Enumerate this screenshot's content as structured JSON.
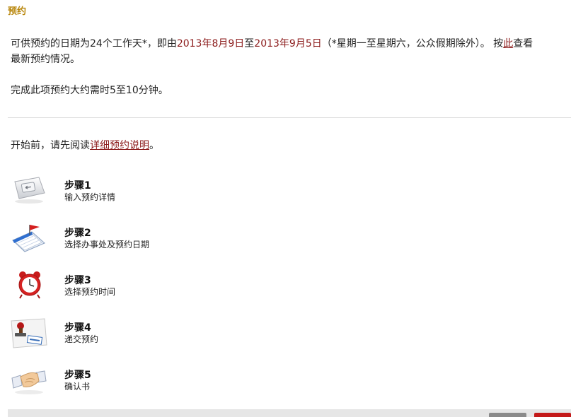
{
  "page": {
    "title": "预约"
  },
  "intro": {
    "line1_a": "可供预约的日期为24个工作天*，即由",
    "start_date": "2013年8月9日",
    "to": "至",
    "end_date": "2013年9月5日",
    "line1_b": "（*星期一至星期六，公众假期除外）。 按",
    "here_link": "此",
    "line1_c": "查看",
    "line2": "最新预约情况。",
    "duration": "完成此项预约大约需时5至10分钟。"
  },
  "before": {
    "prefix": "开始前，请先阅读",
    "link": "详细预约说明",
    "suffix": "。"
  },
  "steps": [
    {
      "title": "步骤1",
      "desc": "输入预约详情",
      "icon": "keyboard-icon"
    },
    {
      "title": "步骤2",
      "desc": "选择办事处及预约日期",
      "icon": "calendar-flag-icon"
    },
    {
      "title": "步骤3",
      "desc": "选择预约时间",
      "icon": "alarm-clock-icon"
    },
    {
      "title": "步骤4",
      "desc": "递交预约",
      "icon": "stamp-icon"
    },
    {
      "title": "步骤5",
      "desc": "确认书",
      "icon": "handshake-icon"
    }
  ],
  "colors": {
    "title": "#b8860b",
    "link": "#8b1a1a",
    "primary_button": "#c41a1a",
    "secondary_button": "#8a8a8a"
  }
}
